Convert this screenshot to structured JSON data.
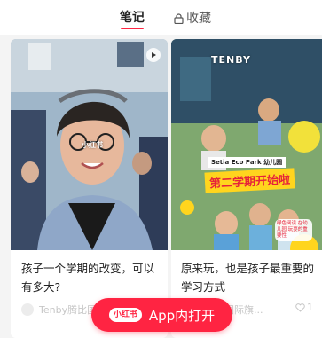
{
  "tabs": {
    "notes": "笔记",
    "favorites": "收藏"
  },
  "cards": [
    {
      "title": "孩子一个学期的改变，可以有多大?",
      "author": "Tenby腾比国",
      "watermark": "小红书"
    },
    {
      "title": "原来玩，也是孩子最重要的学习方式",
      "author": "国际旗...",
      "likes": "1",
      "overlay": {
        "school": "TENBY",
        "school_sub": "Setia Eco Park 幼儿园",
        "headline": "第二学期开始啦",
        "bubble": "绿色阅读 在幼儿园 玩耍的重要性"
      }
    }
  ],
  "app_button": {
    "logo": "小红书",
    "label": "App内打开"
  },
  "colors": {
    "brand": "#ff2442",
    "headline_bg": "#ffd51e"
  }
}
